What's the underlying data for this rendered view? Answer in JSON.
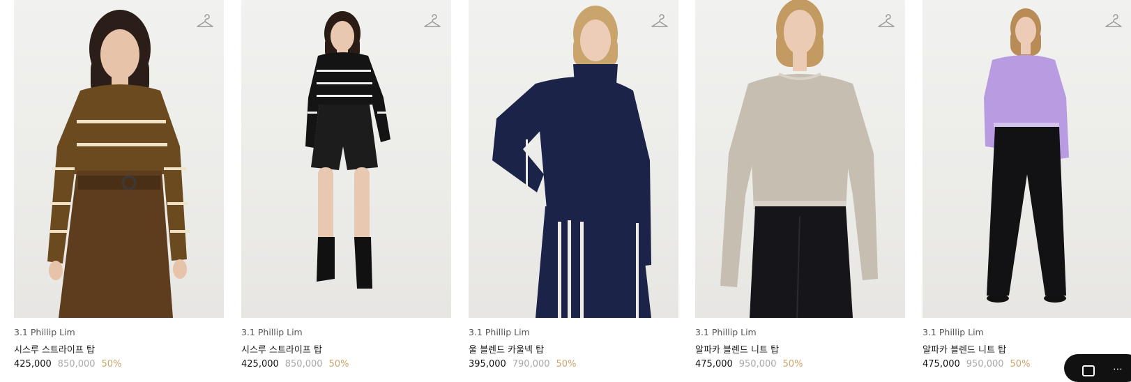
{
  "products": [
    {
      "brand": "3.1 Phillip Lim",
      "name": "시스루 스트라이프 탑",
      "sale_price": "425,000",
      "original_price": "850,000",
      "discount": "50%",
      "icon": "hanger-icon",
      "colors": {
        "top": "#6b4a1f",
        "stripe": "#efe2c6",
        "bottom": "#5e3d1f",
        "hair": "#2b1d17",
        "skin": "#e7c3aa"
      }
    },
    {
      "brand": "3.1 Phillip Lim",
      "name": "시스루 스트라이프 탑",
      "sale_price": "425,000",
      "original_price": "850,000",
      "discount": "50%",
      "icon": "hanger-icon",
      "colors": {
        "top": "#141414",
        "stripe": "#f2f2f2",
        "bottom": "#1c1c1c",
        "hair": "#2a1c15",
        "skin": "#e9c8b2"
      }
    },
    {
      "brand": "3.1 Phillip Lim",
      "name": "울 블렌드 카울넥 탑",
      "sale_price": "395,000",
      "original_price": "790,000",
      "discount": "50%",
      "icon": "hanger-icon",
      "colors": {
        "top": "#1c2348",
        "stripe": "#f0ece4",
        "bottom": "#1c2348",
        "hair": "#c9a56d",
        "skin": "#edcdb7"
      }
    },
    {
      "brand": "3.1 Phillip Lim",
      "name": "알파카 블렌드 니트 탑",
      "sale_price": "475,000",
      "original_price": "950,000",
      "discount": "50%",
      "icon": "hanger-icon",
      "colors": {
        "top": "#c7beb2",
        "stripe": "#d9d2c8",
        "bottom": "#16161a",
        "hair": "#c49a63",
        "skin": "#eccbb5"
      }
    },
    {
      "brand": "3.1 Phillip Lim",
      "name": "알파카 블렌드 니트 탑",
      "sale_price": "475,000",
      "original_price": "950,000",
      "discount": "50%",
      "icon": "hanger-icon",
      "colors": {
        "top": "#b89be0",
        "stripe": "#d3c2ee",
        "bottom": "#121214",
        "hair": "#b98b57",
        "skin": "#ecccb6"
      }
    }
  ],
  "floating_button": {
    "icon": "chat-icon",
    "color": "#111111"
  }
}
